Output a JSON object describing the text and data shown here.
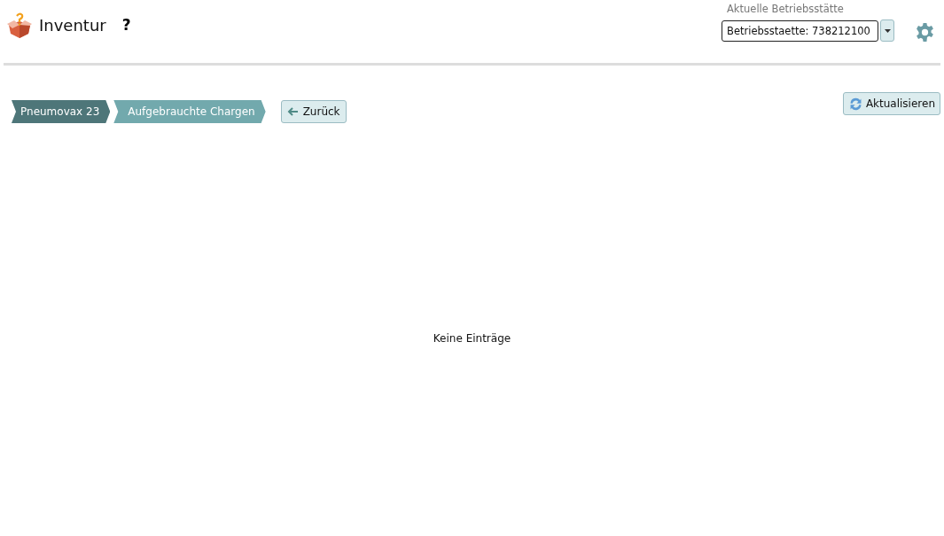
{
  "header": {
    "title": "Inventur",
    "help": "?",
    "site_label": "Aktuelle Betriebsstätte",
    "site_value": "Betriebsstaette: 738212100"
  },
  "breadcrumbs": [
    {
      "label": "Pneumovax 23",
      "selected": false
    },
    {
      "label": "Aufgebrauchte Chargen",
      "selected": true
    }
  ],
  "back_button": "Zurück",
  "refresh_button": "Aktualisieren",
  "empty_message": "Keine Einträge"
}
